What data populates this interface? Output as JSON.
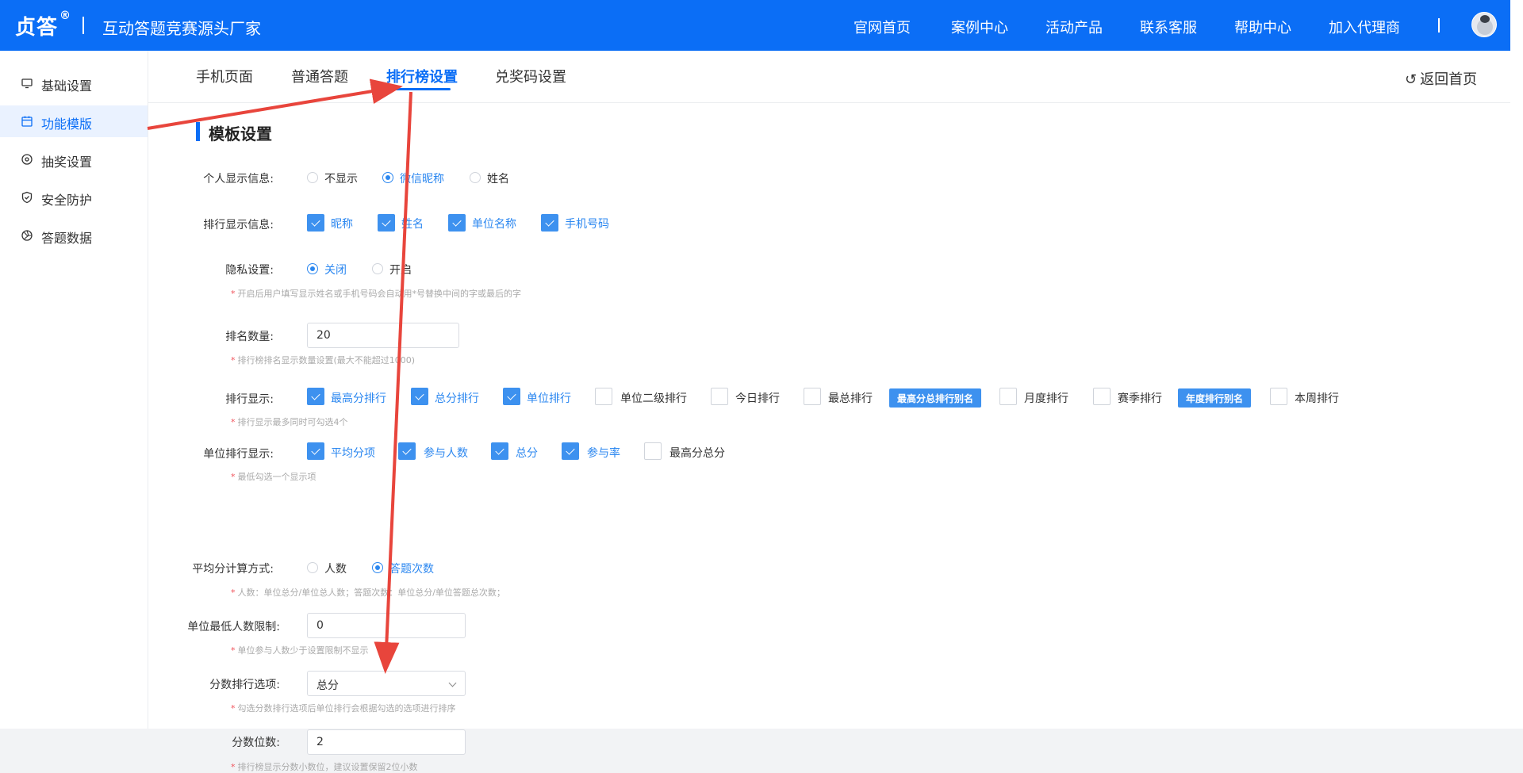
{
  "header": {
    "logo": "贞答",
    "logo_mark": "®",
    "slogan": "互动答题竞赛源头厂家",
    "nav": [
      "官网首页",
      "案例中心",
      "活动产品",
      "联系客服",
      "帮助中心",
      "加入代理商"
    ],
    "nav_separator": "|"
  },
  "sidebar": {
    "items": [
      {
        "label": "基础设置",
        "icon": "monitor-icon"
      },
      {
        "label": "功能模版",
        "icon": "calendar-icon",
        "active": true
      },
      {
        "label": "抽奖设置",
        "icon": "settings-icon"
      },
      {
        "label": "安全防护",
        "icon": "shield-icon"
      },
      {
        "label": "答题数据",
        "icon": "aperture-icon"
      }
    ]
  },
  "tabs": {
    "items": [
      "手机页面",
      "普通答题",
      "排行榜设置",
      "兑奖码设置"
    ],
    "active": "排行榜设置",
    "back": "返回首页"
  },
  "section": {
    "title": "模板设置"
  },
  "form": {
    "personal_info": {
      "label": "个人显示信息:",
      "options": [
        "不显示",
        "微信昵称",
        "姓名"
      ],
      "selected": "微信昵称"
    },
    "rank_info": {
      "label": "排行显示信息:",
      "options": [
        "昵称",
        "姓名",
        "单位名称",
        "手机号码"
      ],
      "checked": [
        "昵称",
        "姓名",
        "单位名称",
        "手机号码"
      ]
    },
    "privacy": {
      "label": "隐私设置:",
      "options": [
        "关闭",
        "开启"
      ],
      "selected": "关闭",
      "hint": "开启后用户填写显示姓名或手机号码会自动用*号替换中间的字或最后的字"
    },
    "rank_count": {
      "label": "排名数量:",
      "value": "20",
      "hint": "排行榜排名显示数量设置(最大不能超过1000)"
    },
    "rank_display": {
      "label": "排行显示:",
      "options": [
        "最高分排行",
        "总分排行",
        "单位排行",
        "单位二级排行",
        "今日排行",
        "最总排行",
        "月度排行",
        "赛季排行",
        "本周排行"
      ],
      "checked": [
        "最高分排行",
        "总分排行",
        "单位排行"
      ],
      "badges": [
        "最高分总排行别名",
        "年度排行别名"
      ],
      "hint": "排行显示最多同时可勾选4个"
    },
    "unit_rank_display": {
      "label": "单位排行显示:",
      "options": [
        "平均分项",
        "参与人数",
        "总分",
        "参与率",
        "最高分总分"
      ],
      "checked": [
        "平均分项",
        "参与人数",
        "总分",
        "参与率"
      ],
      "hint": "最低勾选一个显示项"
    },
    "avg_method": {
      "label": "平均分计算方式:",
      "options": [
        "人数",
        "答题次数"
      ],
      "selected": "答题次数",
      "hint": "人数：单位总分/单位总人数；答题次数：单位总分/单位答题总次数；"
    },
    "unit_min": {
      "label": "单位最低人数限制:",
      "value": "0",
      "hint": "单位参与人数少于设置限制不显示"
    },
    "score_sort": {
      "label": "分数排行选项:",
      "value": "总分",
      "hint": "勾选分数排行选项后单位排行会根据勾选的选项进行排序"
    },
    "decimals": {
      "label": "分数位数:",
      "value": "2",
      "hint": "排行榜显示分数小数位，建议设置保留2位小数"
    }
  },
  "colors": {
    "brand": "#0b6ef6",
    "accent": "#3d91ef",
    "annotation": "#e8453c"
  }
}
